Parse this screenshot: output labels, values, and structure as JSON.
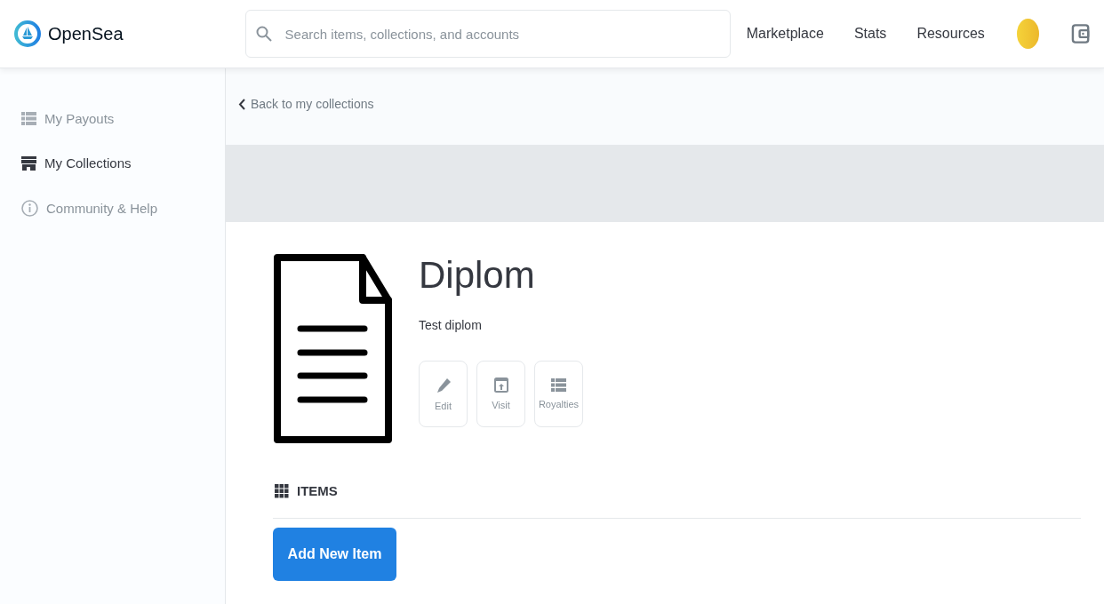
{
  "header": {
    "logo": "OpenSea",
    "search": {
      "placeholder": "Search items, collections, and accounts"
    },
    "nav": [
      "Marketplace",
      "Stats",
      "Resources"
    ]
  },
  "sidebar": {
    "items": [
      {
        "label": "My Payouts",
        "kind": "list",
        "selected": false
      },
      {
        "label": "My Collections",
        "kind": "store",
        "selected": true
      },
      {
        "label": "Community & Help",
        "kind": "info",
        "selected": false
      }
    ]
  },
  "back_link": "Back to my collections",
  "collection": {
    "title": "Diplom",
    "description": "Test diplom",
    "actions": [
      {
        "label": "Edit",
        "kind": "edit"
      },
      {
        "label": "Visit",
        "kind": "visit"
      },
      {
        "label": "Royalties",
        "kind": "list"
      }
    ]
  },
  "items_section": {
    "heading": "ITEMS",
    "button": "Add New Item"
  }
}
